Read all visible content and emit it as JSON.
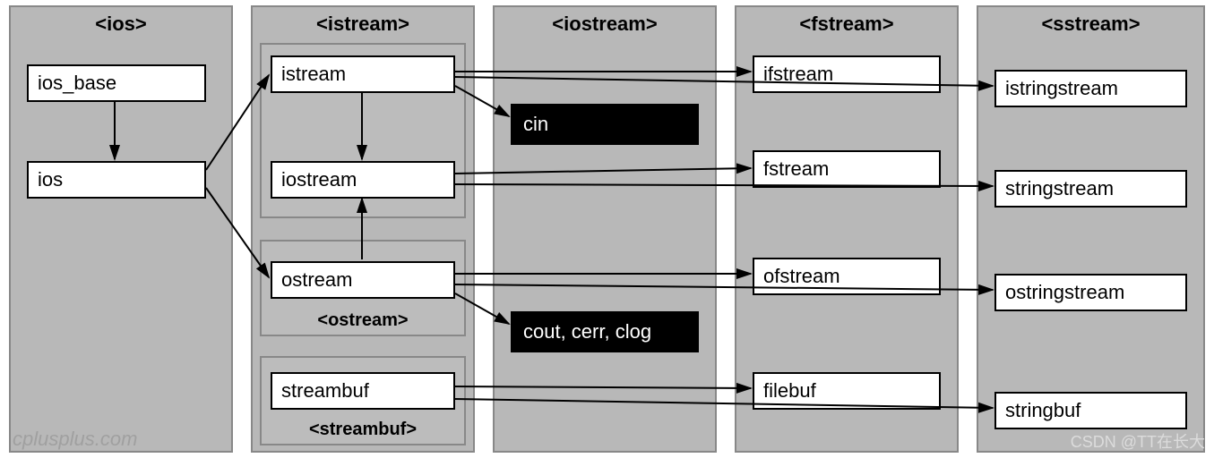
{
  "panels": {
    "ios": {
      "title": "<ios>"
    },
    "istream": {
      "title": "<istream>"
    },
    "iostream": {
      "title": "<iostream>"
    },
    "fstream": {
      "title": "<fstream>"
    },
    "sstream": {
      "title": "<sstream>"
    }
  },
  "subpanels": {
    "ostream": {
      "title": "<ostream>"
    },
    "streambuf": {
      "title": "<streambuf>"
    }
  },
  "boxes": {
    "ios_base": "ios_base",
    "ios": "ios",
    "istream": "istream",
    "iostream": "iostream",
    "ostream": "ostream",
    "streambuf": "streambuf",
    "ifstream": "ifstream",
    "fstream": "fstream",
    "ofstream": "ofstream",
    "filebuf": "filebuf",
    "istringstream": "istringstream",
    "stringstream": "stringstream",
    "ostringstream": "ostringstream",
    "stringbuf": "stringbuf",
    "cin": "cin",
    "cout": "cout, cerr, clog"
  },
  "watermarks": {
    "cplusplus": "cplusplus.com",
    "csdn": "CSDN @TT在长大"
  }
}
